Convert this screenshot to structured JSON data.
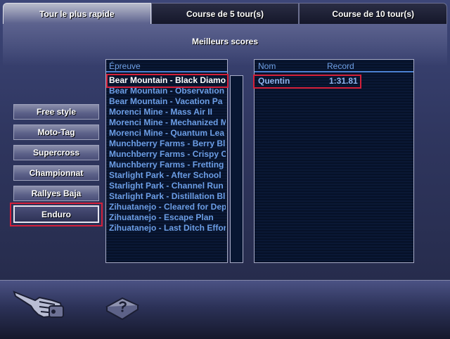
{
  "tabs": [
    {
      "label": "Tour le plus rapide",
      "active": true
    },
    {
      "label": "Course de 5 tour(s)",
      "active": false
    },
    {
      "label": "Course de 10 tour(s)",
      "active": false
    }
  ],
  "heading": "Meilleurs scores",
  "modes": [
    {
      "label": "Free style",
      "selected": false
    },
    {
      "label": "Moto-Tag",
      "selected": false
    },
    {
      "label": "Supercross",
      "selected": false
    },
    {
      "label": "Championnat",
      "selected": false
    },
    {
      "label": "Rallyes Baja",
      "selected": false
    },
    {
      "label": "Enduro",
      "selected": true
    }
  ],
  "events": {
    "header": "Épreuve",
    "items": [
      "Bear Mountain - Black Diamo",
      "Bear Mountain - Observation",
      "Bear Mountain - Vacation Pa",
      "Morenci Mine - Mass Air II",
      "Morenci Mine - Mechanized M",
      "Morenci Mine - Quantum Lea",
      "Munchberry Farms - Berry Bl",
      "Munchberry Farms - Crispy C",
      "Munchberry Farms - Fretting",
      "Starlight Park - After School",
      "Starlight Park - Channel Run",
      "Starlight Park - Distillation Bl",
      "Zihuatanejo - Cleared for Dep",
      "Zihuatanejo - Escape Plan",
      "Zihuatanejo - Last Ditch Effor"
    ],
    "selected_index": 0
  },
  "scores": {
    "name_header": "Nom",
    "record_header": "Record",
    "rows": [
      {
        "name": "Quentin",
        "record": "1:31.81"
      }
    ]
  },
  "icons": {
    "back": "pointing-hand-icon",
    "help": "help-book-icon"
  },
  "colors": {
    "accent_text": "#6c9ee6",
    "highlight_border": "#d4203a"
  }
}
